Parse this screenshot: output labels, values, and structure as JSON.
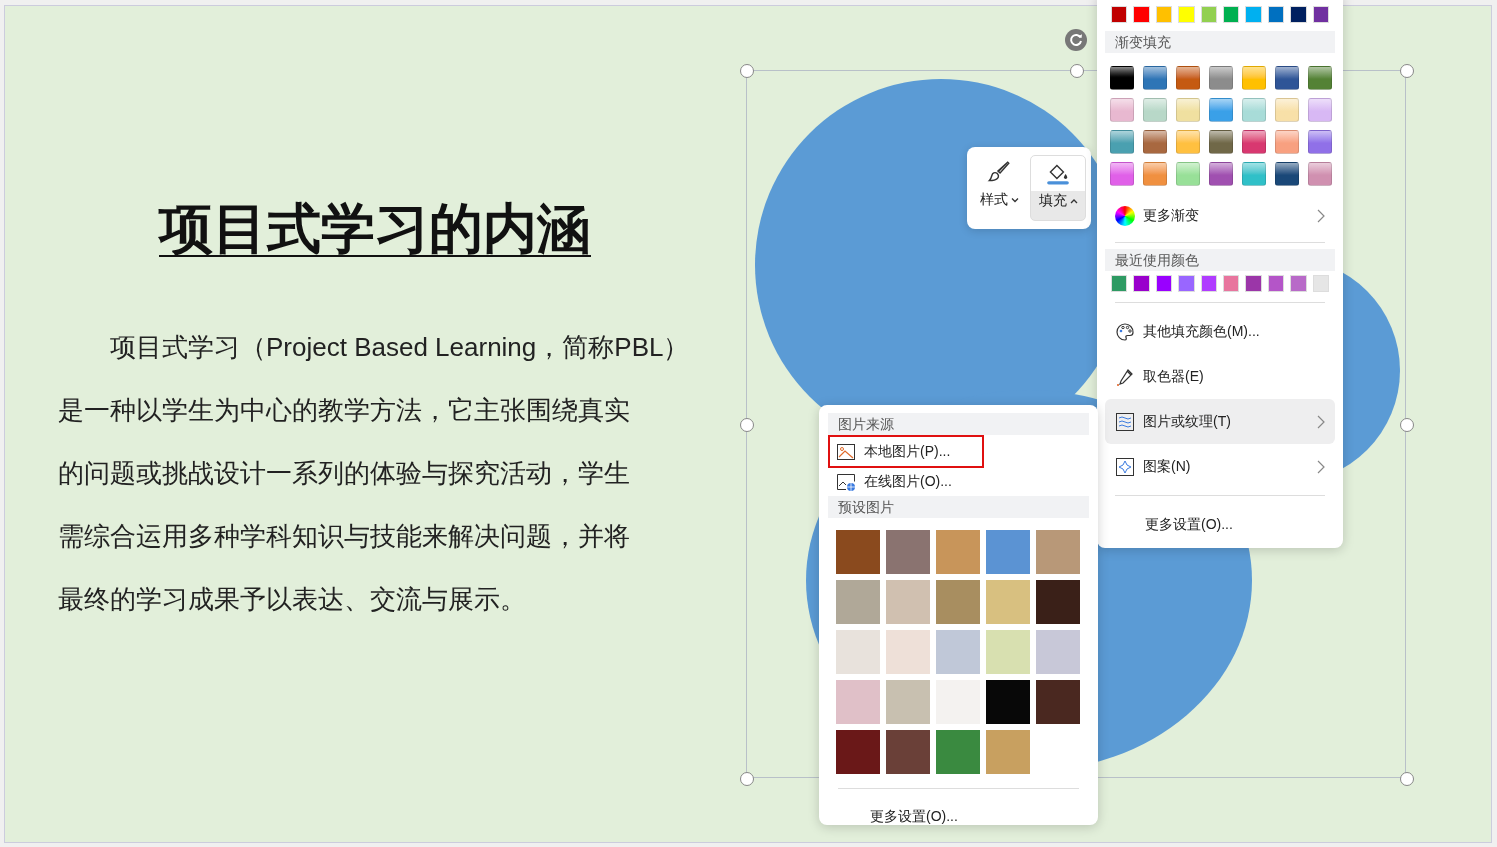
{
  "slide": {
    "title": "项目式学习的内涵",
    "body_lines": [
      "项目式学习（Project Based Learning，简称PBL）",
      "是一种以学生为中心的教学方法，它主张围绕真实",
      "的问题或挑战设计一系列的体验与探究活动，学生",
      "需综合运用多种学科知识与技能来解决问题，并将",
      "最终的学习成果予以表达、交流与展示。"
    ]
  },
  "mini_toolbar": {
    "buttons": [
      {
        "label": "样式",
        "kind": "style",
        "selected": false,
        "expanded": false
      },
      {
        "label": "填充",
        "kind": "fill",
        "selected": true,
        "expanded": true
      }
    ]
  },
  "fill_menu": {
    "standard_colors": [
      {
        "color": "#c00000"
      },
      {
        "color": "#ff0000"
      },
      {
        "color": "#ffc000"
      },
      {
        "color": "#ffff00"
      },
      {
        "color": "#92d050"
      },
      {
        "color": "#00b050"
      },
      {
        "color": "#00b0f0"
      },
      {
        "color": "#0070c0"
      },
      {
        "color": "#002060"
      },
      {
        "color": "#7030a0"
      }
    ],
    "gradient_header": "渐变填充",
    "gradients": [
      {
        "color": "#000000"
      },
      {
        "color": "#2e75b6"
      },
      {
        "color": "#c55a11"
      },
      {
        "color": "#8c8c8c"
      },
      {
        "color": "#ffc000"
      },
      {
        "color": "#2f5597"
      },
      {
        "color": "#548235"
      },
      {
        "color": "#e8b8d0"
      },
      {
        "color": "#b8d8c8"
      },
      {
        "color": "#f0e0a0"
      },
      {
        "color": "#3aa0e8"
      },
      {
        "color": "#a8dcd8"
      },
      {
        "color": "#f8e0a8"
      },
      {
        "color": "#d8b8f4"
      },
      {
        "color": "#4aa0b0"
      },
      {
        "color": "#a86840"
      },
      {
        "color": "#ffc040"
      },
      {
        "color": "#706848"
      },
      {
        "color": "#d83870"
      },
      {
        "color": "#f8a080"
      },
      {
        "color": "#9070e8"
      },
      {
        "color": "#e060e8"
      },
      {
        "color": "#f09040"
      },
      {
        "color": "#98e098"
      },
      {
        "color": "#a050b0"
      },
      {
        "color": "#30c0c8"
      },
      {
        "color": "#1a4878"
      },
      {
        "color": "#d090b0"
      }
    ],
    "more_gradients": "更多渐变",
    "recent_header": "最近使用颜色",
    "recent_colors": [
      {
        "color": "#2e9a63"
      },
      {
        "color": "#9900cc"
      },
      {
        "color": "#9900ff"
      },
      {
        "color": "#9966ff"
      },
      {
        "color": "#b03cff"
      },
      {
        "color": "#e8759e"
      },
      {
        "color": "#9b36a8"
      },
      {
        "color": "#b455c8"
      },
      {
        "color": "#b86ac8"
      },
      {
        "color": "#e6e6e6"
      }
    ],
    "items": [
      {
        "label": "其他填充颜色(M)...",
        "kind": "palette",
        "selected": false,
        "submenu": false
      },
      {
        "label": "取色器(E)",
        "kind": "eyedropper",
        "selected": false,
        "submenu": false
      },
      {
        "label": "图片或纹理(T)",
        "kind": "texture",
        "selected": true,
        "submenu": true
      },
      {
        "label": "图案(N)",
        "kind": "pattern",
        "selected": false,
        "submenu": true
      }
    ],
    "more_settings": "更多设置(O)..."
  },
  "picture_menu": {
    "source_header": "图片来源",
    "items": [
      {
        "label": "本地图片(P)...",
        "kind": "local",
        "outlined": true
      },
      {
        "label": "在线图片(O)...",
        "kind": "online",
        "outlined": false
      }
    ],
    "preset_header": "预设图片",
    "textures": [
      {
        "color": "#8a4a1e"
      },
      {
        "color": "#8a7370"
      },
      {
        "color": "#c8955a"
      },
      {
        "color": "#5b93d3"
      },
      {
        "color": "#b89878"
      },
      {
        "color": "#b0a898"
      },
      {
        "color": "#d0c0b0"
      },
      {
        "color": "#a88e60"
      },
      {
        "color": "#d8c080"
      },
      {
        "color": "#3a2018"
      },
      {
        "color": "#e8e2dc"
      },
      {
        "color": "#eee0d8"
      },
      {
        "color": "#c0c8d8"
      },
      {
        "color": "#d8e0b0"
      },
      {
        "color": "#c8c8d8"
      },
      {
        "color": "#e0c0c8"
      },
      {
        "color": "#c8c0b0"
      },
      {
        "color": "#f4f2f0"
      },
      {
        "color": "#080808"
      },
      {
        "color": "#4a2820"
      },
      {
        "color": "#6a1818"
      },
      {
        "color": "#6a4038"
      },
      {
        "color": "#3a8a40"
      },
      {
        "color": "#c8a060"
      }
    ],
    "more_settings": "更多设置(O)..."
  }
}
